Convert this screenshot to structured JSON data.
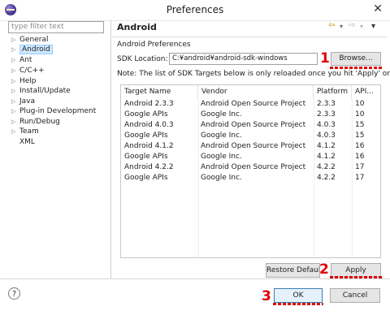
{
  "window": {
    "title": "Preferences",
    "close_glyph": "✕"
  },
  "sidebar": {
    "filter_placeholder": "type filter text",
    "items": [
      {
        "label": "General",
        "arrow": "▷"
      },
      {
        "label": "Android",
        "arrow": "▷",
        "selected": true
      },
      {
        "label": "Ant",
        "arrow": "▷"
      },
      {
        "label": "C/C++",
        "arrow": "▷"
      },
      {
        "label": "Help",
        "arrow": "▷"
      },
      {
        "label": "Install/Update",
        "arrow": "▷"
      },
      {
        "label": "Java",
        "arrow": "▷"
      },
      {
        "label": "Plug-in Development",
        "arrow": "▷"
      },
      {
        "label": "Run/Debug",
        "arrow": "▷"
      },
      {
        "label": "Team",
        "arrow": "▷"
      },
      {
        "label": "XML",
        "arrow": ""
      }
    ]
  },
  "page": {
    "title": "Android",
    "nav_back": "⇦",
    "nav_back_menu": "▾",
    "nav_forward": "⇨",
    "nav_forward_menu": "▾",
    "view_menu": "▾",
    "section_label": "Android Preferences",
    "sdk_label": "SDK Location:",
    "sdk_value": "C:¥android¥android-sdk-windows",
    "browse_label": "Browse...",
    "note": "Note: The list of SDK Targets below is only reloaded once you hit 'Apply' or 'OK'."
  },
  "table": {
    "columns": [
      "Target Name",
      "Vendor",
      "Platform",
      "API..."
    ],
    "rows": [
      [
        "Android 2.3.3",
        "Android Open Source Project",
        "2.3.3",
        "10"
      ],
      [
        "Google APIs",
        "Google Inc.",
        "2.3.3",
        "10"
      ],
      [
        "Android 4.0.3",
        "Android Open Source Project",
        "4.0.3",
        "15"
      ],
      [
        "Google APIs",
        "Google Inc.",
        "4.0.3",
        "15"
      ],
      [
        "Android 4.1.2",
        "Android Open Source Project",
        "4.1.2",
        "16"
      ],
      [
        "Google APIs",
        "Google Inc.",
        "4.1.2",
        "16"
      ],
      [
        "Android 4.2.2",
        "Android Open Source Project",
        "4.2.2",
        "17"
      ],
      [
        "Google APIs",
        "Google Inc.",
        "4.2.2",
        "17"
      ]
    ]
  },
  "buttons": {
    "restore_defaults": "Restore Default",
    "apply": "Apply",
    "ok": "OK",
    "cancel": "Cancel",
    "help": "?"
  },
  "annotations": {
    "one": "1",
    "two": "2",
    "three": "3",
    "color": "#e00000"
  }
}
